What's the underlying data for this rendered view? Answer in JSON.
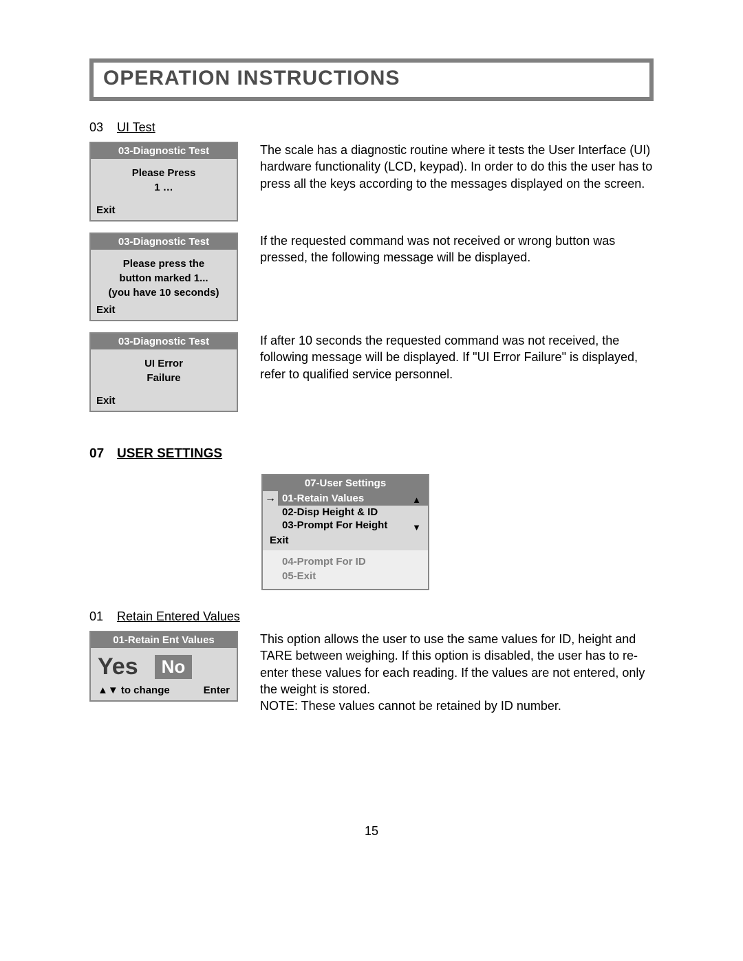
{
  "page_title": "OPERATION INSTRUCTIONS",
  "page_number": "15",
  "sec03": {
    "num": "03",
    "label": "UI Test"
  },
  "screen1": {
    "title": "03-Diagnostic Test",
    "line1": "Please Press",
    "line2": "1 …",
    "exit": "Exit"
  },
  "desc1": "The scale has a diagnostic routine where it tests the User Interface (UI) hardware functionality (LCD, keypad). In order to do this the user has to press all the keys according to the messages displayed on the screen.",
  "screen2": {
    "title": "03-Diagnostic Test",
    "line1": "Please press the",
    "line2": "button marked 1...",
    "line3": "(you have 10 seconds)",
    "exit": "Exit"
  },
  "desc2": "If the requested command was not received or wrong button was pressed, the following message will be displayed.",
  "screen3": {
    "title": "03-Diagnostic Test",
    "line1": "UI Error",
    "line2": "Failure",
    "exit": "Exit"
  },
  "desc3": "If after 10 seconds the requested command was not received, the following message will be displayed. If \"UI Error Failure\" is displayed, refer to qualified service personnel.",
  "sec07": {
    "num": "07",
    "label": "USER SETTINGS"
  },
  "menu": {
    "title": "07-User Settings",
    "arrow": "→",
    "up": "▲",
    "down": "▼",
    "sel": "01-Retain Values",
    "i2": "02-Disp Height & ID",
    "i3": "03-Prompt For Height",
    "exit": "Exit",
    "i4": "04-Prompt For ID",
    "i5": "05-Exit"
  },
  "sec01": {
    "num": "01",
    "label": "Retain Entered Values"
  },
  "retain": {
    "title": "01-Retain Ent Values",
    "yes": "Yes",
    "no": "No",
    "change": "▲▼ to change",
    "enter": "Enter"
  },
  "desc_retain": "This option allows the user to use the same values for ID, height and TARE between weighing. If this option is disabled, the user has to re-enter these values for each reading. If the values are not entered, only the weight is stored.\nNOTE: These values cannot be retained by ID number."
}
